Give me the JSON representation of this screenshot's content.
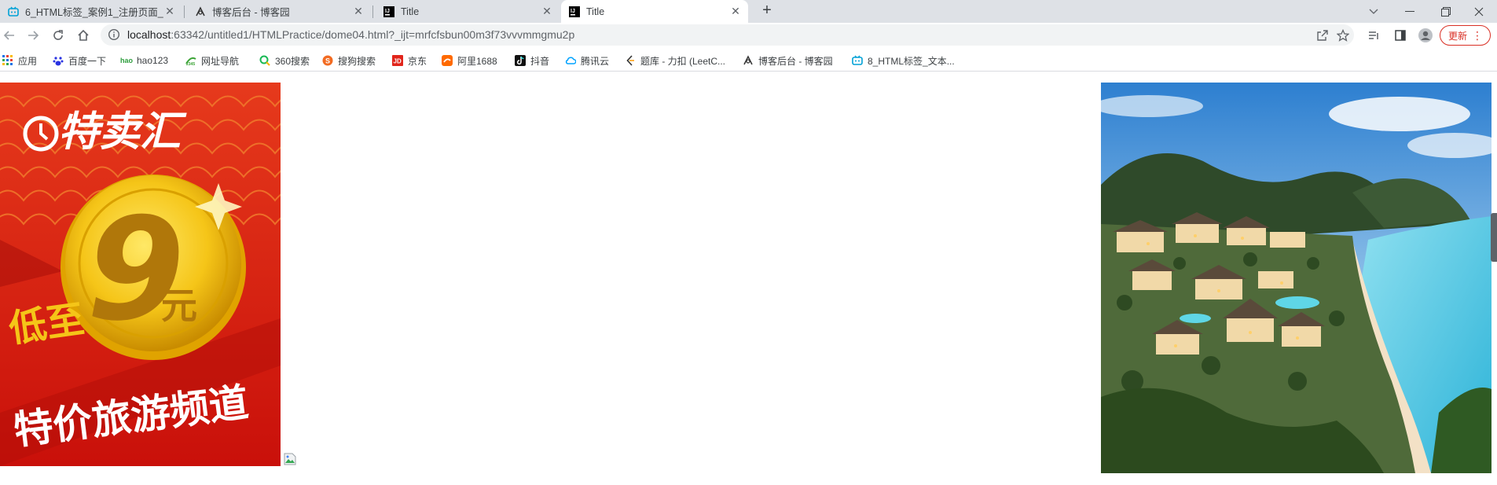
{
  "tabs": [
    {
      "title": "6_HTML标签_案例1_注册页面_",
      "icon": "bilibili-icon",
      "active": false
    },
    {
      "title": "博客后台 - 博客园",
      "icon": "cnblogs-icon",
      "active": false
    },
    {
      "title": "Title",
      "icon": "intellij-icon",
      "active": false
    },
    {
      "title": "Title",
      "icon": "intellij-icon",
      "active": true
    }
  ],
  "address": {
    "host": "localhost",
    "path": ":63342/untitled1/HTMLPractice/dome04.html?_ijt=mrfcfsbun00m3f73vvvmmgmu2p"
  },
  "update_label": "更新",
  "bookmarks": [
    {
      "label": "应用",
      "icon": "apps-grid-icon",
      "color": "#1a73e8"
    },
    {
      "label": "百度一下",
      "icon": "baidu-icon",
      "color": "#2932e1"
    },
    {
      "label": "hao123",
      "icon": "hao123-icon",
      "color": "#2e9e3e"
    },
    {
      "label": "网址导航",
      "icon": "2345-icon",
      "color": "#3aa335"
    },
    {
      "label": "360搜索",
      "icon": "360-search-icon",
      "color": "#19b955"
    },
    {
      "label": "搜狗搜索",
      "icon": "sogou-icon",
      "color": "#f26b22"
    },
    {
      "label": "京东",
      "icon": "jd-icon",
      "color": "#e1251b"
    },
    {
      "label": "阿里1688",
      "icon": "alibaba-1688-icon",
      "color": "#ff6a00"
    },
    {
      "label": "抖音",
      "icon": "douyin-icon",
      "color": "#111111"
    },
    {
      "label": "腾讯云",
      "icon": "tencent-cloud-icon",
      "color": "#00a3ff"
    },
    {
      "label": "题库 - 力扣 (LeetC...",
      "icon": "leetcode-icon",
      "color": "#ffa116"
    },
    {
      "label": "博客后台 - 博客园",
      "icon": "cnblogs-icon",
      "color": "#333333"
    },
    {
      "label": "8_HTML标签_文本...",
      "icon": "bilibili-icon",
      "color": "#00a1d6"
    }
  ],
  "banner": {
    "logo_text": "特卖汇",
    "coin_number": "9",
    "coin_unit": "元",
    "prefix": "低至",
    "tagline": "特价旅游频道",
    "bg_color": "#d91e10",
    "coin_color": "#f5c518"
  },
  "photo": {
    "subject": "tropical-resort-coastline"
  }
}
